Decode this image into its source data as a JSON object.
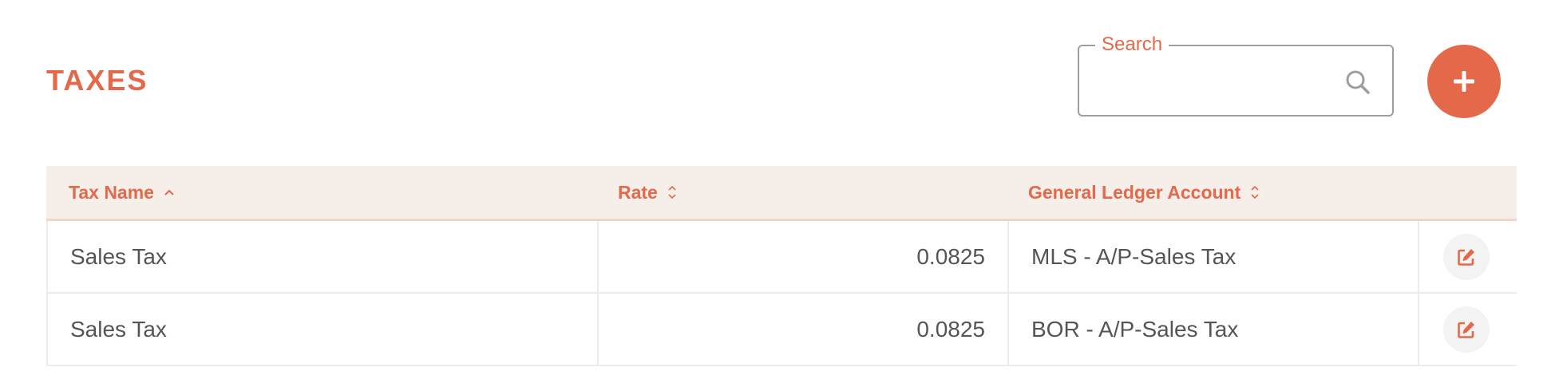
{
  "page": {
    "title": "TAXES"
  },
  "search": {
    "label": "Search",
    "value": "",
    "placeholder": ""
  },
  "colors": {
    "accent": "#E4694A",
    "header_bg": "#F5EEE9",
    "text": "#555555"
  },
  "table": {
    "columns": [
      {
        "label": "Tax Name",
        "sort": "ascending"
      },
      {
        "label": "Rate",
        "sort": "none"
      },
      {
        "label": "General Ledger Account",
        "sort": "none"
      }
    ],
    "rows": [
      {
        "name": "Sales Tax",
        "rate": "0.0825",
        "account": "MLS - A/P-Sales Tax"
      },
      {
        "name": "Sales Tax",
        "rate": "0.0825",
        "account": "BOR - A/P-Sales Tax"
      }
    ]
  },
  "icons": {
    "search": "search-icon",
    "add": "plus-icon",
    "edit": "edit-icon",
    "sort_asc": "chevron-up-icon",
    "sort_both": "sort-icon"
  }
}
